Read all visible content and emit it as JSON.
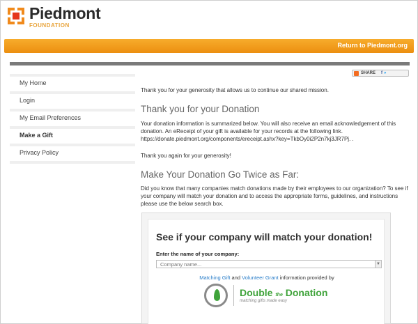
{
  "header": {
    "logo_name": "Piedmont",
    "logo_sub": "FOUNDATION",
    "return_link": "Return to Piedmont.org",
    "brand_color": "#f5a123"
  },
  "share": {
    "label": "SHARE",
    "services": "f",
    "services2": "»"
  },
  "sidebar": {
    "items": [
      {
        "label": "My Home"
      },
      {
        "label": "Login"
      },
      {
        "label": "My Email Preferences"
      },
      {
        "label": "Make a Gift",
        "active": true
      },
      {
        "label": "Privacy Policy"
      }
    ]
  },
  "main": {
    "intro": "Thank you for your generosity that allows us to continue our shared mission.",
    "heading1": "Thank you for your Donation",
    "para1": "Your donation information is summarized below. You will also receive an email acknowledgement of this donation.  An eReceipt of your gift is available for your records at the following link.",
    "receipt_link": "https://donate.piedmont.org/components/ereceipt.ashx?key=TkbOy0i2P2n7kj3JR7Pj.  .",
    "thanks_again": "Thank you again for your generosity!",
    "heading2": "Make Your Donation Go Twice as Far:",
    "para2": "Did you know that many companies match donations made by their employees to our organization? To see if your company will match your donation and to access the appropriate forms, guidelines, and instructions please use the below search box."
  },
  "match": {
    "title": "See if your company will match your donation!",
    "label": "Enter the name of your company:",
    "placeholder": "Company name...",
    "provided_link1": "Matching Gift",
    "provided_and": " and ",
    "provided_link2": "Volunteer Grant",
    "provided_rest": " information provided by",
    "dd_name_a": "Double",
    "dd_the": "the",
    "dd_name_b": "Donation",
    "dd_tag": "matching gifts made easy"
  }
}
